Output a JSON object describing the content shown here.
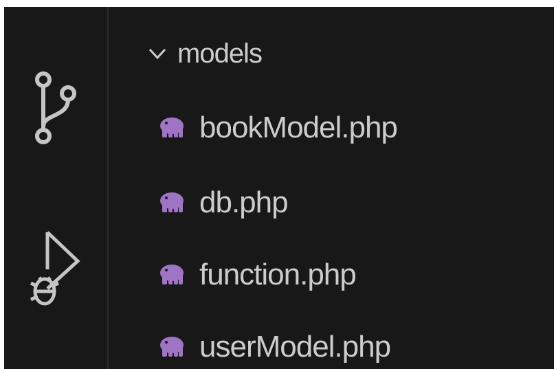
{
  "activity_bar": {
    "items": [
      {
        "icon": "source-control-icon"
      },
      {
        "icon": "run-and-debug-icon"
      }
    ]
  },
  "explorer": {
    "folder": {
      "name": "models",
      "expanded": true,
      "icon": "chevron-down-icon"
    },
    "files": [
      {
        "name": "bookModel.php",
        "icon": "php-elephant-icon"
      },
      {
        "name": "db.php",
        "icon": "php-elephant-icon"
      },
      {
        "name": "function.php",
        "icon": "php-elephant-icon"
      },
      {
        "name": "userModel.php",
        "icon": "php-elephant-icon"
      }
    ]
  },
  "colors": {
    "background": "#181818",
    "text": "#cccccc",
    "icon_gray": "#c5c5c5",
    "php_icon": "#a074c4"
  }
}
